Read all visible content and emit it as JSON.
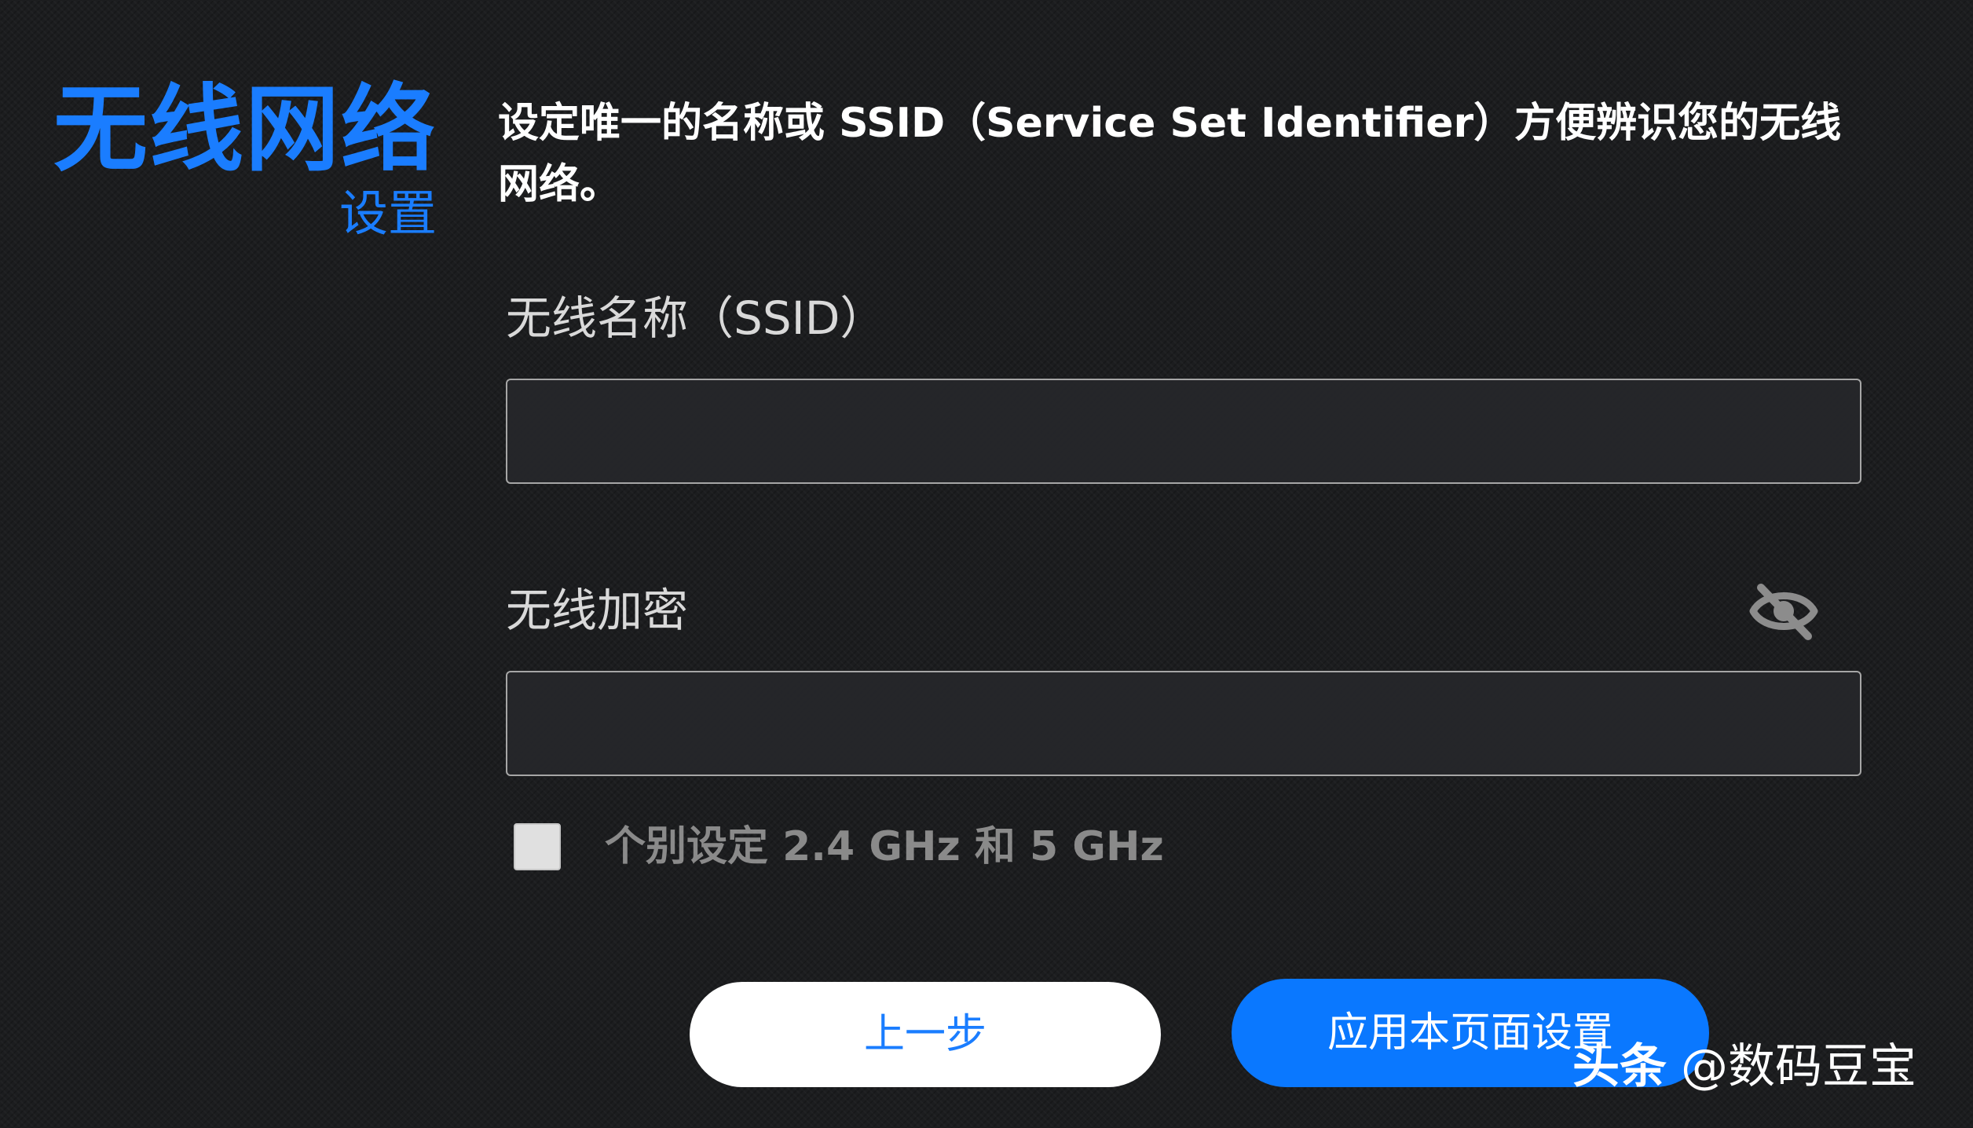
{
  "header": {
    "title": "无线网络",
    "subtitle": "设置",
    "description": "设定唯一的名称或 SSID（Service Set Identifier）方便辨识您的无线网络。"
  },
  "ssid": {
    "label": "无线名称（SSID）",
    "value": ""
  },
  "password": {
    "label": "无线加密",
    "value": "",
    "toggle_icon": "eye-off-icon"
  },
  "separate_bands": {
    "label": "个别设定 2.4 GHz 和 5 GHz",
    "checked": false
  },
  "buttons": {
    "back_label": "上一步",
    "apply_label": "应用本页面设置"
  },
  "watermark": {
    "brand": "头条",
    "handle": "@数码豆宝"
  },
  "colors": {
    "accent": "#1a7dff",
    "apply_button": "#0a78ff",
    "background": "#1c1d1f"
  }
}
